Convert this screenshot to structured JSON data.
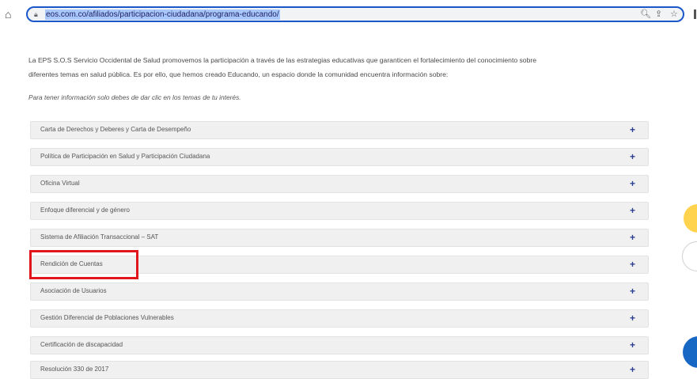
{
  "browser": {
    "url": "eos.com.co/afiliados/participacion-ciudadana/programa-educando/",
    "home_icon": "home-icon",
    "lock_icon": "lock-icon",
    "zoom_icon": "zoom-icon",
    "share_icon": "share-icon",
    "star_icon": "star-icon"
  },
  "content": {
    "intro_line1": "La EPS S.O.S Servicio Occidental de Salud promovemos la participación a través de las estrategias educativas que garanticen el fortalecimiento del conocimiento sobre",
    "intro_line2": "diferentes temas en salud pública. Es por ello, que hemos creado Educando, un espacio donde la comunidad encuentra información sobre:",
    "hint": "Para tener información solo debes de dar clic en los temas de tu interés."
  },
  "accordion": {
    "items": [
      {
        "label": "Carta de Derechos y Deberes y Carta de Desempeño"
      },
      {
        "label": "Política de Participación en Salud y Participación Ciudadana"
      },
      {
        "label": "Oficina Virtual"
      },
      {
        "label": "Enfoque diferencial y de género"
      },
      {
        "label": "Sistema de Afiliación Transaccional – SAT"
      },
      {
        "label": "Rendición de Cuentas"
      },
      {
        "label": "Asociación de Usuarios"
      },
      {
        "label": "Gestión Diferencial de Poblaciones Vulnerables"
      },
      {
        "label": "Certificación de discapacidad"
      },
      {
        "label": "Resolución 330 de 2017"
      }
    ],
    "expand_symbol": "+"
  },
  "colors": {
    "highlight_box": "#e0161c",
    "accent_plus": "#2c3e91"
  }
}
